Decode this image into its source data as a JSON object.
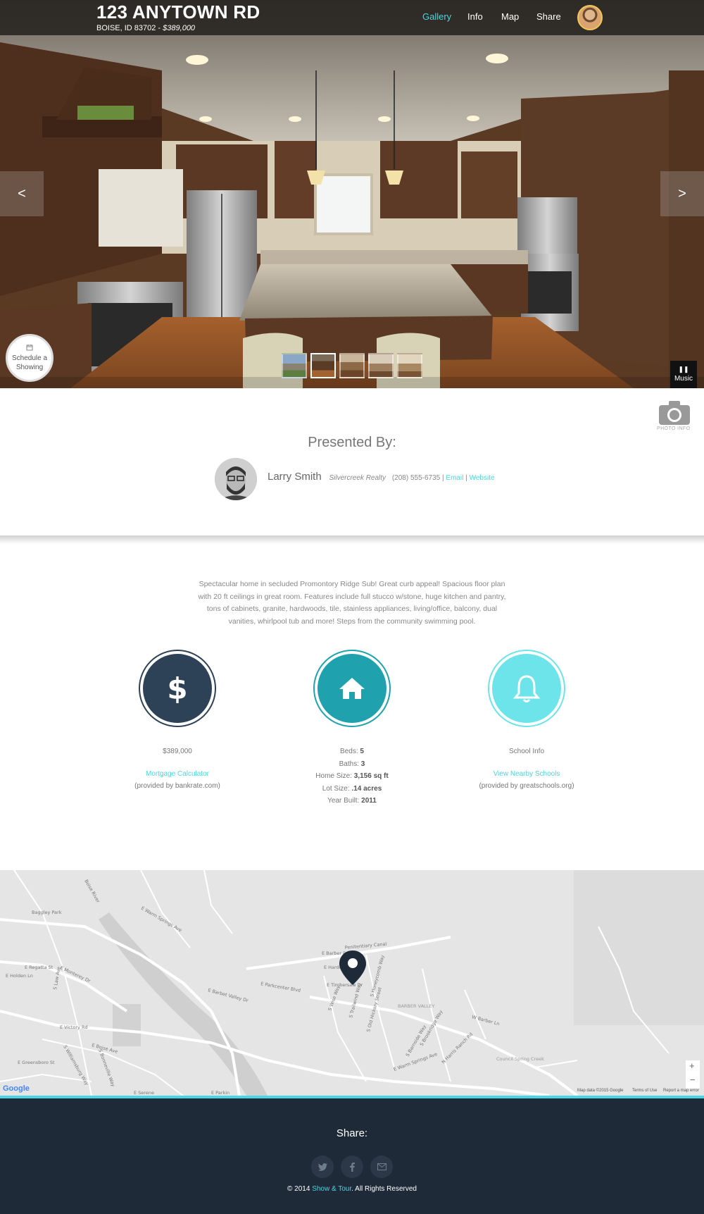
{
  "header": {
    "title": "123 ANYTOWN RD",
    "address": "BOISE, ID 83702 -",
    "price": "$389,000"
  },
  "nav": [
    {
      "label": "Gallery",
      "active": true
    },
    {
      "label": "Info",
      "active": false
    },
    {
      "label": "Map",
      "active": false
    },
    {
      "label": "Share",
      "active": false
    }
  ],
  "gallery": {
    "prev_label": "<",
    "next_label": ">",
    "schedule_line1": "Schedule a",
    "schedule_line2": "Showing",
    "music_label": "Music",
    "photo_info_label": "PHOTO INFO"
  },
  "presented": {
    "heading": "Presented By:",
    "name": "Larry Smith",
    "company": "Silvercreek Realty",
    "phone": "(208) 555-6735",
    "email_label": "Email",
    "website_label": "Website"
  },
  "description": "Spectacular home in secluded Promontory Ridge Sub! Great curb appeal! Spacious floor plan with 20 ft ceilings in great room. Features include full stucco w/stone, huge kitchen and pantry, tons of cabinets, granite, hardwoods, tile, stainless appliances, living/office, balcony, dual vanities, whirlpool tub and more! Steps from the community swimming pool.",
  "features": {
    "price": {
      "value": "$389,000",
      "link": "Mortgage Calculator",
      "provider": "(provided by bankrate.com)"
    },
    "home": {
      "beds_label": "Beds:",
      "beds": "5",
      "baths_label": "Baths:",
      "baths": "3",
      "size_label": "Home Size:",
      "size": "3,156 sq ft",
      "lot_label": "Lot Size:",
      "lot": ".14 acres",
      "year_label": "Year Built:",
      "year": "2011"
    },
    "school": {
      "label": "School Info",
      "link": "View Nearby Schools",
      "provider": "(provided by greatschools.org)"
    }
  },
  "map": {
    "streets": [
      "E Barber Dr",
      "E Warm Springs Ave",
      "E Parkcenter Blvd",
      "E Timbersaw Dr",
      "E Harder",
      "E Barbet Valley Dr",
      "E Regatta St",
      "E Monterey Dr",
      "E Victory Rd",
      "E Boise Ave",
      "E Greensboro St",
      "E Holden Ln",
      "Baggley Park",
      "BARBER VALLEY",
      "Council Spring Creek",
      "W Barber Ln",
      "Penitentiary Canal",
      "S Wise Way",
      "S Trailwind Way",
      "S Honeycomb Way",
      "S Old Hickory Street",
      "S Barnside Way",
      "S Brookridge Way",
      "N Harris Ranch Rd",
      "E Warm Springs Ave",
      "Boise River",
      "S Law Ave",
      "E Serene",
      "E Parkin",
      "S Williamsburg Way",
      "S Bonneville Way"
    ],
    "zoom_in": "+",
    "zoom_out": "−",
    "google_label": "Google",
    "map_data": "Map data ©2015 Google",
    "terms": "Terms of Use",
    "report": "Report a map error"
  },
  "footer": {
    "share_label": "Share:",
    "copyright_prefix": "© 2014",
    "brand": "Show & Tour",
    "copyright_suffix": ". All Rights Reserved",
    "social": [
      {
        "icon": "twitter-icon"
      },
      {
        "icon": "facebook-icon"
      },
      {
        "icon": "email-icon"
      }
    ]
  },
  "colors": {
    "accent": "#4ad6e0",
    "navy": "#2e4257",
    "teal": "#1fa2ae",
    "light_teal": "#6de3ea",
    "footer_bg": "#1e2a38"
  }
}
